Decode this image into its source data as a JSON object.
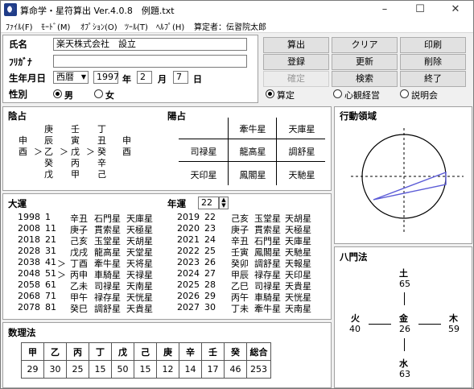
{
  "window": {
    "title": "算命学・星符算出 Ver.4.0.8　例題.txt",
    "controls": {
      "minimize": "–",
      "maximize": "☐",
      "close": "✕"
    }
  },
  "menu": [
    "ﾌｧｲﾙ(F)",
    "ﾓｰﾄﾞ(M)",
    "ｵﾌﾟｼｮﾝ(O)",
    "ﾂｰﾙ(T)",
    "ﾍﾙﾌﾟ(H)",
    "算定者：伝習院太郎"
  ],
  "form": {
    "name_label": "氏名",
    "name_value": "楽天株式会社　設立",
    "kana_label": "ﾌﾘｶﾞﾅ",
    "kana_value": "",
    "birth_label": "生年月日",
    "era": "西暦",
    "year": "1997",
    "year_unit": "年",
    "month": "2",
    "month_unit": "月",
    "day": "7",
    "day_unit": "日",
    "sex_label": "性別",
    "sex_male": "男",
    "sex_female": "女"
  },
  "buttons": {
    "calc": "算出",
    "clear": "クリア",
    "print": "印刷",
    "register": "登録",
    "update": "更新",
    "delete": "削除",
    "confirm": "確定",
    "search": "検索",
    "exit": "終了"
  },
  "modes": [
    "算定",
    "心観経営",
    "説明会"
  ],
  "inyin": {
    "title": "陰占",
    "cols": [
      [
        "",
        "申",
        "酉"
      ],
      [
        "庚",
        "辰",
        "乙",
        "癸",
        "戊"
      ],
      [
        "壬",
        "寅",
        "戊",
        "丙",
        "甲"
      ],
      [
        "丁",
        "丑",
        "癸",
        "辛",
        "己"
      ],
      [
        "",
        "申",
        "酉"
      ]
    ],
    "arrows": [
      "＞",
      "＞",
      "＞"
    ]
  },
  "yosen": {
    "title": "陽占",
    "cells": [
      "牽牛星",
      "天庫星",
      "司禄星",
      "龍高星",
      "調舒星",
      "天印星",
      "鳳閣星",
      "天馳星"
    ]
  },
  "kodo": {
    "title": "行動領域"
  },
  "taiun": {
    "title": "大運",
    "rows": [
      [
        "1998",
        "1",
        "",
        "辛丑",
        "石門星",
        "天庫星"
      ],
      [
        "2008",
        "11",
        "",
        "庚子",
        "貫索星",
        "天極星"
      ],
      [
        "2018",
        "21",
        "",
        "己亥",
        "玉堂星",
        "天胡星"
      ],
      [
        "2028",
        "31",
        "",
        "戊戌",
        "龍高星",
        "天堂星"
      ],
      [
        "2038",
        "41",
        "＞",
        "丁酉",
        "牽牛星",
        "天将星"
      ],
      [
        "2048",
        "51",
        "＞",
        "丙申",
        "車騎星",
        "天禄星"
      ],
      [
        "2058",
        "61",
        "",
        "乙未",
        "司禄星",
        "天南星"
      ],
      [
        "2068",
        "71",
        "",
        "甲午",
        "禄存星",
        "天恍星"
      ],
      [
        "2078",
        "81",
        "",
        "癸巳",
        "調舒星",
        "天貴星"
      ]
    ]
  },
  "nenun": {
    "title": "年運",
    "year_select": "22",
    "rows": [
      [
        "2019",
        "22",
        "己亥",
        "玉堂星",
        "天胡星"
      ],
      [
        "2020",
        "23",
        "庚子",
        "貫索星",
        "天極星"
      ],
      [
        "2021",
        "24",
        "辛丑",
        "石門星",
        "天庫星"
      ],
      [
        "2022",
        "25",
        "壬寅",
        "鳳閣星",
        "天馳星"
      ],
      [
        "2023",
        "26",
        "癸卯",
        "調舒星",
        "天報星"
      ],
      [
        "2024",
        "27",
        "甲辰",
        "禄存星",
        "天印星"
      ],
      [
        "2025",
        "28",
        "乙巳",
        "司禄星",
        "天貴星"
      ],
      [
        "2026",
        "29",
        "丙午",
        "車騎星",
        "天恍星"
      ],
      [
        "2027",
        "30",
        "丁未",
        "牽牛星",
        "天南星"
      ]
    ]
  },
  "surihou": {
    "title": "数理法",
    "headers": [
      "甲",
      "乙",
      "丙",
      "丁",
      "戊",
      "己",
      "庚",
      "辛",
      "壬",
      "癸",
      "総合"
    ],
    "values": [
      "29",
      "30",
      "25",
      "15",
      "50",
      "15",
      "12",
      "14",
      "17",
      "46",
      "253"
    ]
  },
  "hachimon": {
    "title": "八門法",
    "top": {
      "label": "土",
      "value": "65"
    },
    "left": {
      "label": "火",
      "value": "40"
    },
    "center": {
      "label": "金",
      "value": "26"
    },
    "right": {
      "label": "木",
      "value": "59"
    },
    "bottom": {
      "label": "水",
      "value": "63"
    }
  },
  "colors": {
    "accent": "#5b5bd6",
    "window_bg": "#f0f0f0",
    "panel_bg": "#ffffff"
  }
}
